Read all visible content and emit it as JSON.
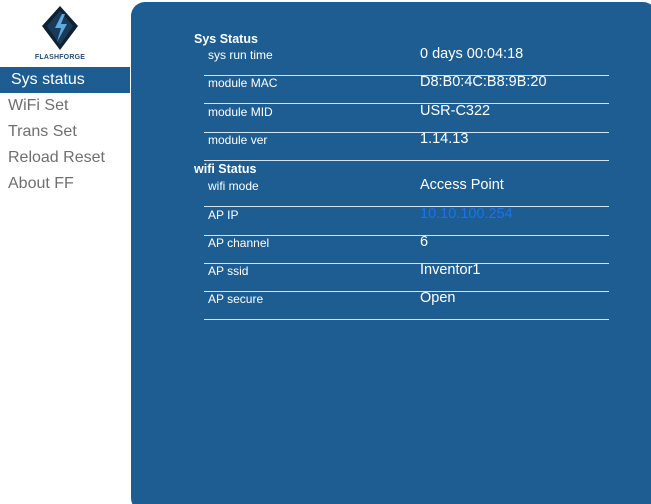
{
  "brand": {
    "logo_text": "FLASHFORGE",
    "colors": {
      "panel": "#1d5d92",
      "active_nav": "#1d5d92",
      "nav_text": "#6f6f6f",
      "link": "#1a73e8"
    }
  },
  "sidebar": {
    "items": [
      {
        "label": "Sys status"
      },
      {
        "label": "WiFi Set"
      },
      {
        "label": "Trans Set"
      },
      {
        "label": "Reload Reset"
      },
      {
        "label": "About FF"
      }
    ]
  },
  "sys_status": {
    "title": "Sys Status",
    "rows": [
      {
        "label": "sys run time",
        "value": "0 days 00:04:18"
      },
      {
        "label": "module MAC",
        "value": "D8:B0:4C:B8:9B:20"
      },
      {
        "label": "module MID",
        "value": "USR-C322"
      },
      {
        "label": "module ver",
        "value": "1.14.13"
      }
    ]
  },
  "wifi_status": {
    "title": "wifi Status",
    "rows": [
      {
        "label": "wifi mode",
        "value": "Access Point"
      },
      {
        "label": "AP IP",
        "value": "10.10.100.254"
      },
      {
        "label": "AP channel",
        "value": "6"
      },
      {
        "label": "AP ssid",
        "value": "Inventor1"
      },
      {
        "label": "AP secure",
        "value": "Open"
      }
    ]
  }
}
